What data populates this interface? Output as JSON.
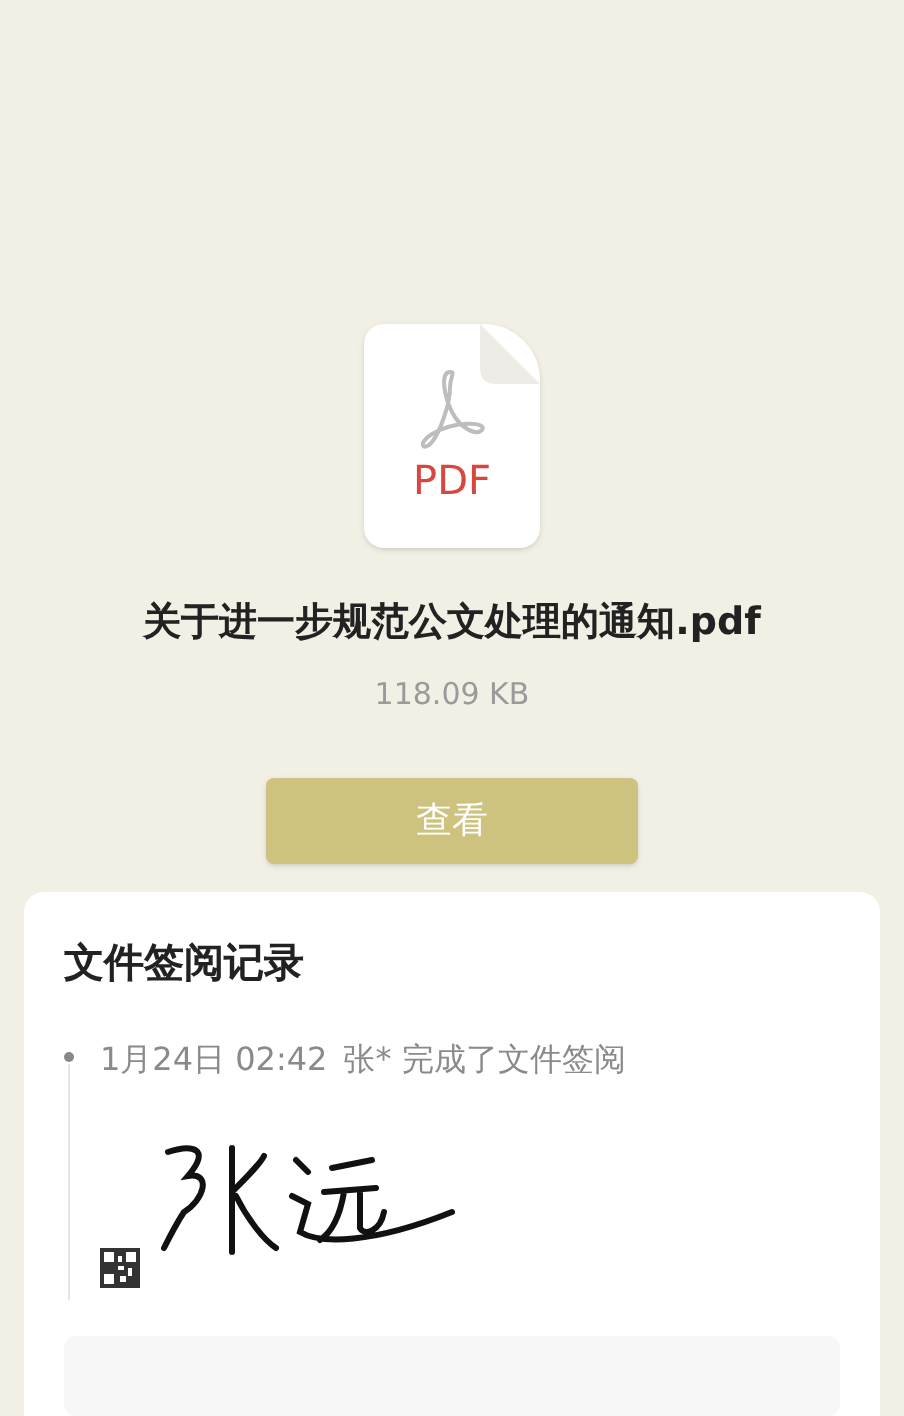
{
  "file": {
    "type_label": "PDF",
    "name": "关于进一步规范公文处理的通知.pdf",
    "size": "118.09 KB"
  },
  "view_button": "查看",
  "records": {
    "title": "文件签阅记录",
    "entries": [
      {
        "time": "1月24日 02:42",
        "person": "张*",
        "action": "完成了文件签阅"
      }
    ]
  }
}
